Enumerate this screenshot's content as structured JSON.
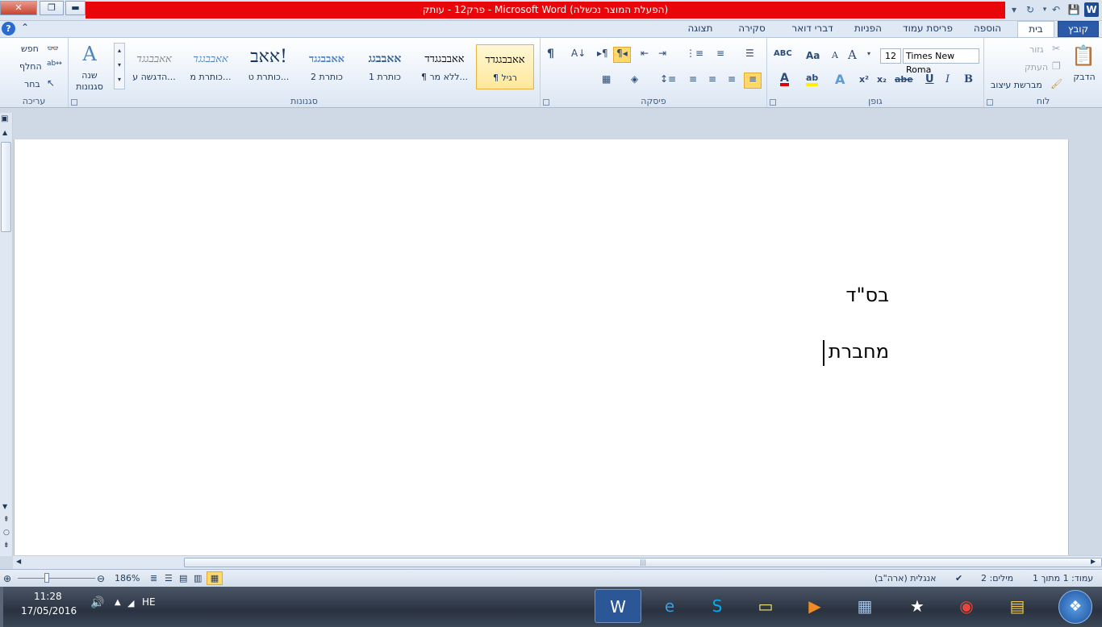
{
  "window": {
    "title": "פרק12 - עותק  -  Microsoft Word (הפעלת המוצר נכשלה)",
    "close_glyph": "✕",
    "restore_glyph": "❐",
    "minimize_glyph": "▬"
  },
  "quick_access": [
    "save-icon",
    "undo-icon",
    "redo-icon",
    "customize-dropdown-icon"
  ],
  "tabs": [
    {
      "label": "קובץ",
      "selected": false,
      "kind": "file"
    },
    {
      "label": "בית",
      "selected": true
    },
    {
      "label": "הוספה",
      "selected": false
    },
    {
      "label": "פריסת עמוד",
      "selected": false
    },
    {
      "label": "הפניות",
      "selected": false
    },
    {
      "label": "דברי דואר",
      "selected": false
    },
    {
      "label": "סקירה",
      "selected": false
    },
    {
      "label": "תצוגה",
      "selected": false
    }
  ],
  "ribbon": {
    "clipboard": {
      "label": "לוח",
      "paste": "הדבק",
      "cut": "גזור",
      "copy": "העתק",
      "format_painter": "מברשת עיצוב"
    },
    "font": {
      "label": "גופן",
      "font_name": "Times New Roma",
      "font_size": "12",
      "bold": "B",
      "italic": "I",
      "underline": "U",
      "strike": "abe",
      "subscript": "x₂",
      "superscript": "x²",
      "grow": "A",
      "shrink": "A",
      "change_case": "Aa"
    },
    "paragraph": {
      "label": "פיסקה",
      "pilcrow": "¶"
    },
    "styles": {
      "label": "סגנונות",
      "items": [
        {
          "preview": "אאבבגגדד",
          "name": "¶ רגיל",
          "selected": true
        },
        {
          "preview": "אאבבגגדד",
          "name": "¶ ללא מר..."
        },
        {
          "preview": "אאבבגג",
          "name": "כותרת 1"
        },
        {
          "preview": "אאבבגגד",
          "name": "כותרת 2"
        },
        {
          "preview": "אאב!",
          "name": "כותרת ט..."
        },
        {
          "preview": "אאבבגגד",
          "name": "כותרת מ..."
        },
        {
          "preview": "אאבבגגד",
          "name": "הדגשה ע..."
        }
      ],
      "change_styles": "שנה\nסגנונות",
      "change_styles_line1": "שנה",
      "change_styles_line2": "סגנונות"
    },
    "editing": {
      "label": "עריכה",
      "find": "חפש",
      "replace": "החלף",
      "select": "בחר"
    }
  },
  "document": {
    "lines": [
      "בס\"ד",
      "מחברת"
    ]
  },
  "status_bar": {
    "page": "עמוד: 1 מתוך 1",
    "words": "מילים: 2",
    "language": "אנגלית (ארה\"ב)",
    "zoom": "186%",
    "zoom_level": 0.37
  },
  "taskbar": {
    "apps": [
      {
        "name": "word",
        "icon": "W",
        "active": true
      },
      {
        "name": "internet-explorer",
        "icon": "e",
        "active": false
      },
      {
        "name": "skype",
        "icon": "S",
        "active": false
      },
      {
        "name": "notes",
        "icon": "▭",
        "active": false
      },
      {
        "name": "media-player",
        "icon": "▶",
        "active": false
      },
      {
        "name": "calculator",
        "icon": "▦",
        "active": false
      },
      {
        "name": "app-star",
        "icon": "★",
        "active": false
      },
      {
        "name": "chrome",
        "icon": "◉",
        "active": false
      },
      {
        "name": "explorer",
        "icon": "▤",
        "active": false
      }
    ],
    "language": "HE",
    "time": "11:28",
    "date": "17/05/2016"
  },
  "colors": {
    "title_red": "#e8060b",
    "file_tab": "#2a5aa8",
    "ribbon_text": "#1e395b",
    "selected_style": "#ffe89a"
  }
}
